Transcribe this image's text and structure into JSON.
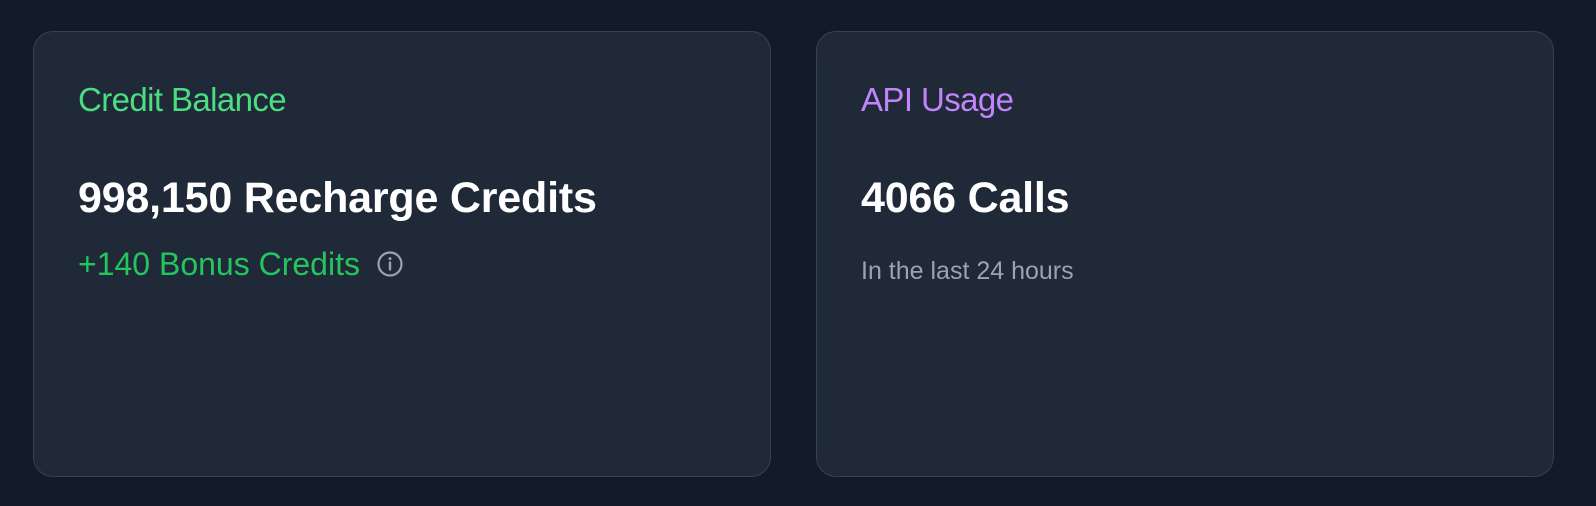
{
  "credit_card": {
    "title": "Credit Balance",
    "recharge_credits": "998,150 Recharge Credits",
    "bonus_credits": "+140 Bonus Credits",
    "info_icon": "info-circle-icon",
    "title_color": "#4ade80",
    "bonus_color": "#22c55e"
  },
  "api_card": {
    "title": "API Usage",
    "calls": "4066 Calls",
    "period": "In the last 24 hours",
    "title_color": "#c084fc"
  }
}
